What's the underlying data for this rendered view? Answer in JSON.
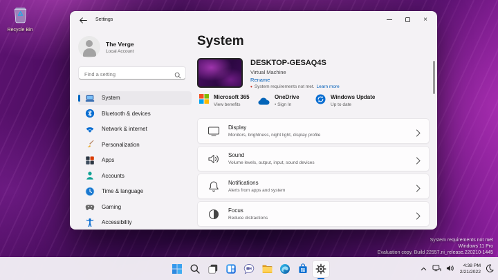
{
  "colors": {
    "accent": "#0067c0",
    "link": "#005fb8",
    "warning_dot": "#c42b1c",
    "window_bg": "#f4f2f5",
    "taskbar_bg": "#f2eef5",
    "wallpaper_base": "#3a0b50"
  },
  "desktop": {
    "recycle_bin_label": "Recycle Bin",
    "watermark": {
      "line1": "System requirements not met",
      "line2": "Windows 11 Pro",
      "line3": "Evaluation copy. Build 22557.ni_release.220210-1445"
    }
  },
  "settings_window": {
    "titlebar": {
      "title": "Settings"
    },
    "sidebar": {
      "user": {
        "name": "The Verge",
        "account_type": "Local Account"
      },
      "search_placeholder": "Find a setting",
      "items": [
        {
          "label": "System",
          "selected": true
        },
        {
          "label": "Bluetooth & devices",
          "selected": false
        },
        {
          "label": "Network & internet",
          "selected": false
        },
        {
          "label": "Personalization",
          "selected": false
        },
        {
          "label": "Apps",
          "selected": false
        },
        {
          "label": "Accounts",
          "selected": false
        },
        {
          "label": "Time & language",
          "selected": false
        },
        {
          "label": "Gaming",
          "selected": false
        },
        {
          "label": "Accessibility",
          "selected": false
        }
      ]
    },
    "main": {
      "page_title": "System",
      "device": {
        "name": "DESKTOP-GESAQ4S",
        "type": "Virtual Machine",
        "rename_link": "Rename",
        "warning_bullet": "•",
        "warning_text": "System requirements not met.",
        "warning_link": "Learn more"
      },
      "quick_links": [
        {
          "title": "Microsoft 365",
          "subtitle": "View benefits"
        },
        {
          "title": "OneDrive",
          "subtitle": "• Sign In"
        },
        {
          "title": "Windows Update",
          "subtitle": "Up to date"
        }
      ],
      "cards": [
        {
          "title": "Display",
          "subtitle": "Monitors, brightness, night light, display profile"
        },
        {
          "title": "Sound",
          "subtitle": "Volume levels, output, input, sound devices"
        },
        {
          "title": "Notifications",
          "subtitle": "Alerts from apps and system"
        },
        {
          "title": "Focus",
          "subtitle": "Reduce distractions"
        }
      ]
    }
  },
  "taskbar": {
    "apps": [
      "start",
      "search",
      "task-view",
      "widgets",
      "chat",
      "file-explorer",
      "edge",
      "store",
      "settings"
    ],
    "active_app": "settings",
    "tray": {
      "time": "4:38 PM",
      "date": "2/21/2022"
    }
  },
  "icons": {
    "back": "←",
    "search": "⌕",
    "minimize": "–",
    "maximize": "□",
    "close": "×",
    "chevron-right": "›",
    "chevron-up": "^",
    "moon": "☾",
    "warning-dot": "•"
  }
}
